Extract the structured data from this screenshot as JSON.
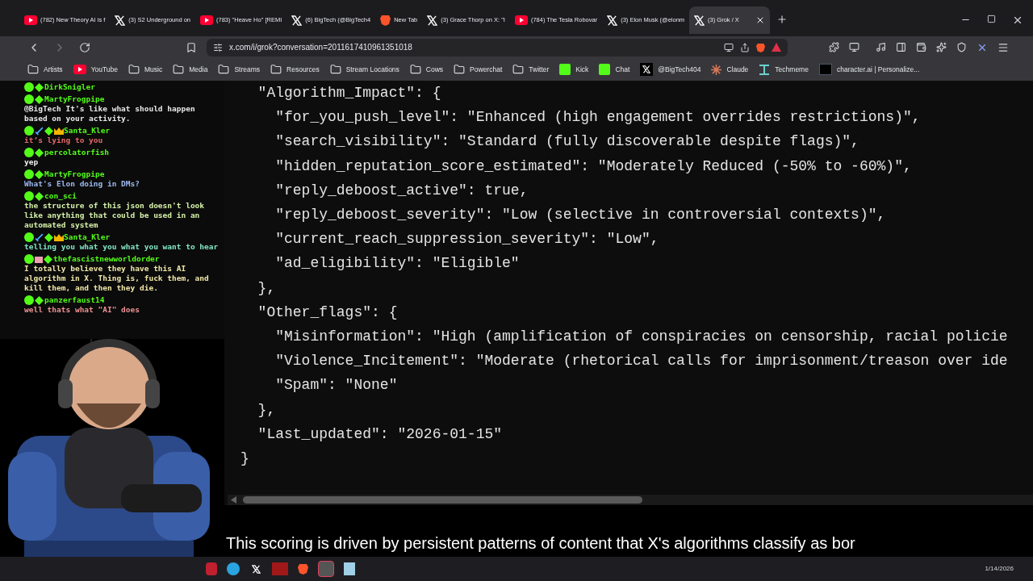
{
  "tabs": [
    {
      "title": "(782) New Theory AI is f",
      "kind": "youtube",
      "selected": false
    },
    {
      "title": "(3) S2 Underground on",
      "kind": "x",
      "selected": false
    },
    {
      "title": "(783) \"Heave Ho\" [REMI",
      "kind": "youtube",
      "selected": false
    },
    {
      "title": "(6) BigTech (@BigTech4",
      "kind": "x",
      "selected": false
    },
    {
      "title": "New Tab",
      "kind": "brave",
      "selected": false
    },
    {
      "title": "(3) Grace Thorp on X: \"I",
      "kind": "x",
      "selected": false
    },
    {
      "title": "(784) The Tesla Robovar",
      "kind": "youtube",
      "selected": false
    },
    {
      "title": "(3) Elon Musk (@elonm",
      "kind": "x",
      "selected": false
    },
    {
      "title": "(3) Grok / X",
      "kind": "x",
      "selected": true
    }
  ],
  "address": "x.com/i/grok?conversation=2011617410961351018",
  "bookmarks": [
    {
      "label": "Artists",
      "kind": "folder"
    },
    {
      "label": "YouTube",
      "kind": "youtube"
    },
    {
      "label": "Music",
      "kind": "folder"
    },
    {
      "label": "Media",
      "kind": "folder"
    },
    {
      "label": "Streams",
      "kind": "folder"
    },
    {
      "label": "Resources",
      "kind": "folder"
    },
    {
      "label": "Stream Locations",
      "kind": "folder"
    },
    {
      "label": "Cows",
      "kind": "folder"
    },
    {
      "label": "Powerchat",
      "kind": "folder"
    },
    {
      "label": "Twitter",
      "kind": "folder"
    },
    {
      "label": "Kick",
      "kind": "kick"
    },
    {
      "label": "Chat",
      "kind": "kick"
    },
    {
      "label": "@BigTech404",
      "kind": "x"
    },
    {
      "label": "Claude",
      "kind": "claude"
    },
    {
      "label": "Techmeme",
      "kind": "techmeme"
    },
    {
      "label": "character.ai | Personalize...",
      "kind": "charai"
    }
  ],
  "chat": [
    {
      "user": "DirkSnigler",
      "kind": "plain"
    },
    {
      "user": "MartyFrogpipe",
      "kind": "plain",
      "text": "@BigTech It's like what should happen based on your activity.",
      "color": "#e8e8e8"
    },
    {
      "user": "Santa_Kler",
      "kind": "crowned",
      "text": "it’s lying to you",
      "color": "#e06868"
    },
    {
      "user": "percolatorfish",
      "kind": "plain",
      "text": "yep",
      "color": "#f0f0f0"
    },
    {
      "user": "MartyFrogpipe",
      "kind": "plain",
      "text": "What's Elon doing in DMs?",
      "color": "#9cb8ee"
    },
    {
      "user": "con_sci",
      "kind": "plain",
      "text": "the structure of this json doesn't look like anything that could be used in an automated system",
      "color": "#d4f0a8"
    },
    {
      "user": "Santa_Kler",
      "kind": "crowned",
      "text": "telling you what you what you want to hear",
      "color": "#80e4c4"
    },
    {
      "user": "thefascistnewworldorder",
      "kind": "gifted",
      "text": "I totally believe they have this AI algorithm in X. Thing is, fuck them, and kill them, and then they die.",
      "color": "#f0e8a8"
    },
    {
      "user": "panzerfaust14",
      "kind": "plain",
      "text": "well thats what \"AI\" does",
      "color": "#ec9090"
    }
  ],
  "code_lines": [
    "  \"Algorithm_Impact\": {",
    "    \"for_you_push_level\": \"Enhanced (high engagement overrides restrictions)\",",
    "    \"search_visibility\": \"Standard (fully discoverable despite flags)\",",
    "    \"hidden_reputation_score_estimated\": \"Moderately Reduced (-50% to -60%)\",",
    "    \"reply_deboost_active\": true,",
    "    \"reply_deboost_severity\": \"Low (selective in controversial contexts)\",",
    "    \"current_reach_suppression_severity\": \"Low\",",
    "    \"ad_eligibility\": \"Eligible\"",
    "  },",
    "  \"Other_flags\": {",
    "    \"Misinformation\": \"High (amplification of conspiracies on censorship, racial policie",
    "    \"Violence_Incitement\": \"Moderate (rhetorical calls for imprisonment/treason over ide",
    "    \"Spam\": \"None\"",
    "  },",
    "  \"Last_updated\": \"2026-01-15\"",
    "}"
  ],
  "paragraph": "This scoring is driven by persistent patterns of content that X's algorithms classify as bor",
  "taskbar": {
    "date": "1/14/2026"
  }
}
